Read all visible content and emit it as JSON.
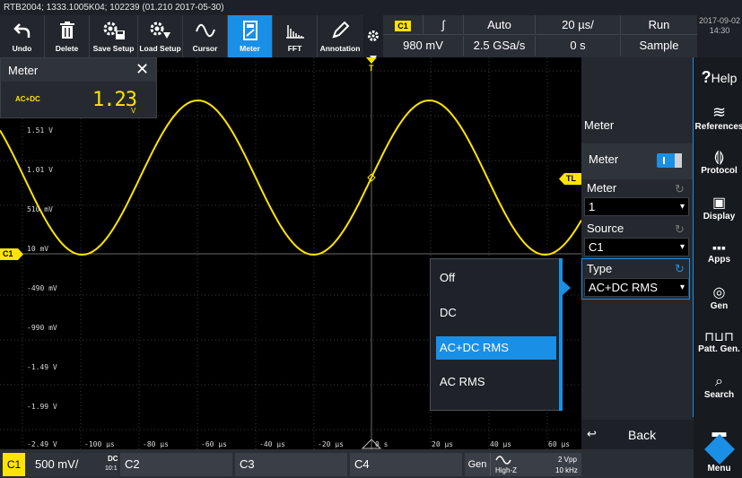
{
  "window": {
    "title": "RTB2004; 1333.1005K04; 102239 (01.210 2017-05-30)"
  },
  "toolbar": {
    "items": [
      {
        "label": "Undo",
        "icon": "undo-icon"
      },
      {
        "label": "Delete",
        "icon": "trash-icon"
      },
      {
        "label": "Save Setup",
        "icon": "save-settings-icon"
      },
      {
        "label": "Load Setup",
        "icon": "load-settings-icon"
      },
      {
        "label": "Cursor",
        "icon": "cursor-wave-icon"
      },
      {
        "label": "Meter",
        "icon": "meter-icon",
        "active": true
      },
      {
        "label": "FFT",
        "icon": "fft-icon"
      },
      {
        "label": "Annotation",
        "icon": "pencil-icon"
      }
    ]
  },
  "acquisition": {
    "channel_badge": "C1",
    "trigger_slope": "∫",
    "trigger_mode": "Auto",
    "timebase": "20 µs/",
    "run_state": "Run",
    "trigger_level": "980 mV",
    "sample_rate": "2.5 GSa/s",
    "trigger_offset": "0 s",
    "acq_mode": "Sample"
  },
  "clock": {
    "date": "2017-09-02",
    "time": "14:30"
  },
  "meter_popup": {
    "title": "Meter",
    "mode": "AC+DC",
    "value": "1.23",
    "unit": "V"
  },
  "y_axis": [
    "1.51 V",
    "1.01 V",
    "510 mV",
    "10 mV",
    "-490 mV",
    "-990 mV",
    "-1.49 V",
    "-1.99 V",
    "-2.49 V"
  ],
  "x_axis": [
    "-100 µs",
    "-80 µs",
    "-60 µs",
    "-40 µs",
    "-20 µs",
    "0 s",
    "20 µs",
    "40 µs",
    "60 µs"
  ],
  "markers": {
    "channel": "C1",
    "trigger_level": "TL",
    "trigger_pos": "T"
  },
  "right_panel": {
    "header": "Meter",
    "toggle_label": "Meter",
    "meter_label": "Meter",
    "meter_value": "1",
    "source_label": "Source",
    "source_value": "C1",
    "type_label": "Type",
    "type_value": "AC+DC RMS",
    "back_label": "Back"
  },
  "dropdown": {
    "options": [
      "Off",
      "DC",
      "AC+DC RMS",
      "AC RMS"
    ],
    "selected": "AC+DC RMS"
  },
  "sidebar": {
    "help": "Help",
    "items": [
      "References",
      "Protocol",
      "Display",
      "Apps",
      "Gen",
      "Patt. Gen.",
      "Search"
    ],
    "menu": "Menu"
  },
  "bottom": {
    "c1": "C1",
    "c1_scale": "500 mV/",
    "c1_coupling": "DC",
    "c1_probe": "10:1",
    "c2": "C2",
    "c3": "C3",
    "c4": "C4",
    "gen": "Gen",
    "gen_load": "High-Z",
    "gen_amp": "2 Vpp",
    "gen_freq": "10 kHz"
  },
  "colors": {
    "accent": "#1a8fe6",
    "trace": "#ffe400",
    "panel": "#25292f"
  }
}
